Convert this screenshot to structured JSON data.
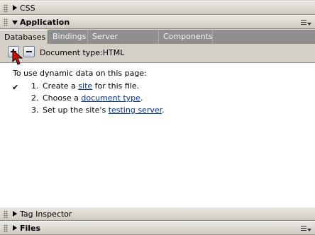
{
  "panels": {
    "css": {
      "label": "CSS"
    },
    "application": {
      "label": "Application"
    },
    "tag_inspector": {
      "label": "Tag Inspector"
    },
    "files": {
      "label": "Files"
    }
  },
  "tabs": [
    {
      "label": "Databases",
      "active": true
    },
    {
      "label": "Bindings",
      "active": false
    },
    {
      "label": "Server Behaviors",
      "active": false
    },
    {
      "label": "Components",
      "active": false
    }
  ],
  "toolbar": {
    "add_icon": "plus-icon",
    "remove_icon": "minus-icon",
    "document_type": "Document type:HTML"
  },
  "content": {
    "intro": "To use dynamic data on this page:",
    "steps": [
      {
        "num": "1.",
        "before": "Create a ",
        "link": "site",
        "after": " for this file.",
        "done": true
      },
      {
        "num": "2.",
        "before": "Choose a ",
        "link": "document type",
        "after": ".",
        "done": false
      },
      {
        "num": "3.",
        "before": "Set up the site's ",
        "link": "testing server",
        "after": ".",
        "done": false
      }
    ],
    "checkmark": "✔"
  },
  "colors": {
    "panel_bg": "#d4d0c8",
    "tab_strip": "#8f8f8f",
    "link": "#00339a",
    "cursor": "#cc1100"
  }
}
